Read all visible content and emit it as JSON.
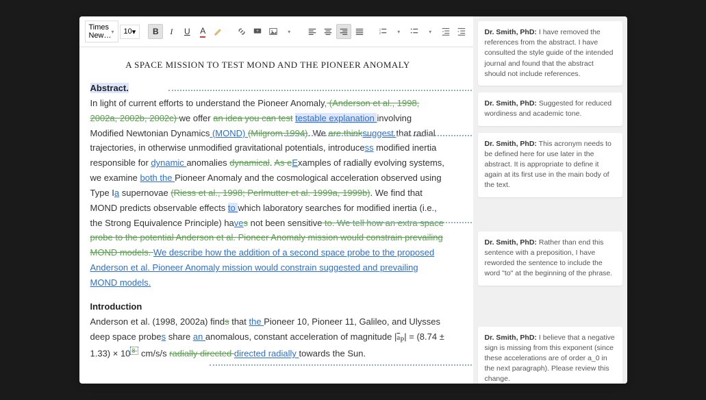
{
  "toolbar": {
    "font_name": "Times New…",
    "font_size": "10"
  },
  "doc": {
    "title": "A SPACE MISSION TO TEST MOND AND THE PIONEER ANOMALY",
    "abstract_heading": "Abstract.",
    "intro_heading": "Introduction",
    "abs": {
      "t1": "In light of current efforts to understand the Pioneer Anomaly",
      "ins_comma": ",",
      "del_refs": " (Anderson et al., 1998, 2002a, 2002b, 2002c) ",
      "t2": "we offer ",
      "del_idea": "an idea you can test",
      "sp1": " ",
      "ins_testable": "testable explanation ",
      "t3": "involving Modified Newtonian Dynamics",
      "ins_mond": " (MOND) ",
      "del_milgrom": "(Milgrom 1994)",
      "t4": ". We ",
      "del_arethink": "are think",
      "ins_suggest": "suggest ",
      "t5": "that radial trajectories, in otherwise unmodified gravitational potentials, introduce",
      "ins_ss": "ss",
      "t6": " modified inertia responsible for ",
      "ins_dynamic": "dynamic ",
      "t7": "anomalies ",
      "del_dynamical": "dynamical",
      "t8": ". ",
      "del_as": "As e",
      "ins_e": "E",
      "t9": "xamples of radially evolving systems, we examine ",
      "ins_both": "both the ",
      "t10": "Pioneer Anomaly and the cosmological acceleration observed using Type ",
      "t_ia": "I",
      "ins_a": "a",
      "t11": " supernovae ",
      "del_riess": "(Riess et al., 1998; Perlmutter et al. 1999a, 1999b)",
      "t12": ". We find that MOND predicts observable effects ",
      "ins_to": "to ",
      "t13": "which laboratory searches for modified inertia (i.e., the Strong Equivalence Principle) ha",
      "ins_ve": "ve",
      "del_s": "s",
      "t14": " not been sensitive",
      "del_tell": " to. We tell how an extra space probe to the potential Anderson et al. Pioneer Anomaly mission would constrain prevailing MOND models. ",
      "ins_describe": "We describe how the addition of a second space probe to the proposed Anderson et al. Pioneer Anomaly mission would constrain suggested and prevailing MOND models."
    },
    "intro": {
      "t1": "Anderson et al. (1998, 2002a) find",
      "del_s2": "s",
      "t2": " that ",
      "ins_the": "the ",
      "t3": "Pioneer 10, Pioneer 11, Galileo, and Ulysses deep space probe",
      "ins_s3": "s",
      "t4": " share ",
      "ins_an": "an ",
      "t5": "anomalous, constant acceleration of magnitude |",
      "formula_ap": "a",
      "formula_sub": "P",
      "t6": "| = (8.74 ± 1.33) × 10",
      "sup_old": "8",
      "sup_new": "-",
      "t7": " cm/s/s ",
      "del_radially": "radially directed ",
      "ins_directed": " directed radially ",
      "t8": "towards the Sun."
    }
  },
  "comments": [
    {
      "author": "Dr. Smith, PhD:",
      "body": "I have removed the references from the abstract. I have consulted the style guide of the intended journal and found that the abstract should not include references."
    },
    {
      "author": "Dr. Smith, PhD:",
      "body": "Suggested for reduced wordiness and academic tone."
    },
    {
      "author": "Dr. Smith, PhD:",
      "body": "This acronym needs to be defined here for use later in the abstract. It is appropriate to define it again at its first use in the main body of the text."
    },
    {
      "author": "Dr. Smith, PhD:",
      "body": "Rather than end this sentence with a preposition, I have reworded the sentence to include the word \"to\" at the beginning of the phrase."
    },
    {
      "author": "Dr. Smith, PhD:",
      "body": "I believe that a negative sign is missing from this exponent (since these accelerations are of order a_0 in the next paragraph). Please review this change."
    }
  ]
}
